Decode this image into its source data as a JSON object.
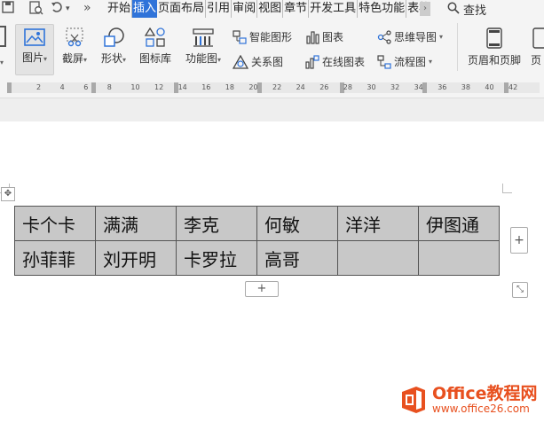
{
  "quick_access": {
    "more": "»"
  },
  "tabs": [
    {
      "label": "开始",
      "active": false
    },
    {
      "label": "插入",
      "active": true
    },
    {
      "label": "页面布局",
      "active": false
    },
    {
      "label": "引用",
      "active": false
    },
    {
      "label": "审阅",
      "active": false
    },
    {
      "label": "视图",
      "active": false
    },
    {
      "label": "章节",
      "active": false
    },
    {
      "label": "开发工具",
      "active": false
    },
    {
      "label": "特色功能",
      "active": false
    },
    {
      "label": "表格",
      "active": false
    }
  ],
  "search": {
    "label": "查找"
  },
  "ribbon": {
    "picture": "图片",
    "screenshot": "截屏",
    "shapes": "形状",
    "icon_library": "图标库",
    "function_chart": "功能图",
    "smart_art": "智能图形",
    "chart": "图表",
    "mind_map": "思维导图",
    "relation_chart": "关系图",
    "online_chart": "在线图表",
    "flowchart": "流程图",
    "header_footer": "页眉和页脚",
    "next_partial": "页"
  },
  "ruler": {
    "numbers": [
      "2",
      "4",
      "6",
      "8",
      "10",
      "12",
      "14",
      "16",
      "18",
      "20",
      "22",
      "24",
      "26",
      "28",
      "30",
      "32",
      "34",
      "36",
      "38",
      "40",
      "42"
    ]
  },
  "table": {
    "rows": [
      [
        "卡个卡",
        "满满",
        "李克",
        "何敏",
        "洋洋",
        "伊图通"
      ],
      [
        "孙菲菲",
        "刘开明",
        "卡罗拉",
        "高哥",
        "",
        ""
      ]
    ],
    "add_symbol": "+"
  },
  "watermark": {
    "brand": "Office教程网",
    "url": "www.office26.com"
  },
  "colors": {
    "accent": "#2f73d9",
    "table_fill": "#c8c8c8",
    "watermark": "#e8501f"
  }
}
